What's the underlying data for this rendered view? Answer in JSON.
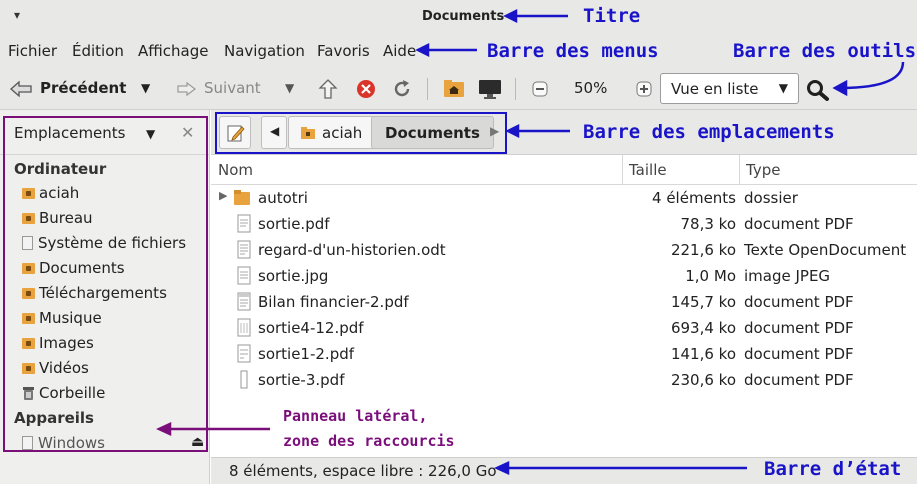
{
  "window": {
    "title": "Documents"
  },
  "menu": [
    "Fichier",
    "Édition",
    "Affichage",
    "Navigation",
    "Favoris",
    "Aide"
  ],
  "toolbar": {
    "back": "Précédent",
    "forward": "Suivant",
    "zoom": "50%",
    "view_mode": "Vue en liste"
  },
  "sidebar": {
    "header": "Emplacements",
    "group_computer": "Ordinateur",
    "items": [
      "aciah",
      "Bureau",
      "Système de fichiers",
      "Documents",
      "Téléchargements",
      "Musique",
      "Images",
      "Vidéos",
      "Corbeille"
    ],
    "group_devices": "Appareils",
    "devices": [
      "Windows"
    ]
  },
  "location": {
    "crumbs": [
      "aciah",
      "Documents"
    ]
  },
  "columns": {
    "name": "Nom",
    "size": "Taille",
    "type": "Type"
  },
  "files": [
    {
      "name": "autotri",
      "size": "4 éléments",
      "type": "dossier"
    },
    {
      "name": "sortie.pdf",
      "size": "78,3 ko",
      "type": "document PDF"
    },
    {
      "name": "regard-d'un-historien.odt",
      "size": "221,6 ko",
      "type": "Texte OpenDocument"
    },
    {
      "name": "sortie.jpg",
      "size": "1,0 Mo",
      "type": "image JPEG"
    },
    {
      "name": "Bilan financier-2.pdf",
      "size": "145,7 ko",
      "type": "document PDF"
    },
    {
      "name": "sortie4-12.pdf",
      "size": "693,4 ko",
      "type": "document PDF"
    },
    {
      "name": "sortie1-2.pdf",
      "size": "141,6 ko",
      "type": "document PDF"
    },
    {
      "name": "sortie-3.pdf",
      "size": "230,6 ko",
      "type": "document PDF"
    }
  ],
  "status": "8 éléments, espace libre : 226,0 Go",
  "annotations": {
    "title": "Titre",
    "menubar": "Barre des menus",
    "toolbar": "Barre des outils",
    "locbar": "Barre des emplacements",
    "sidebar_line1": "Panneau latéral,",
    "sidebar_line2": "zone des raccourcis",
    "statusbar": "Barre d’état"
  },
  "colors": {
    "annotation_blue": "#1a14c9",
    "annotation_purple": "#7a0f7a",
    "folder": "#e8a33e"
  }
}
